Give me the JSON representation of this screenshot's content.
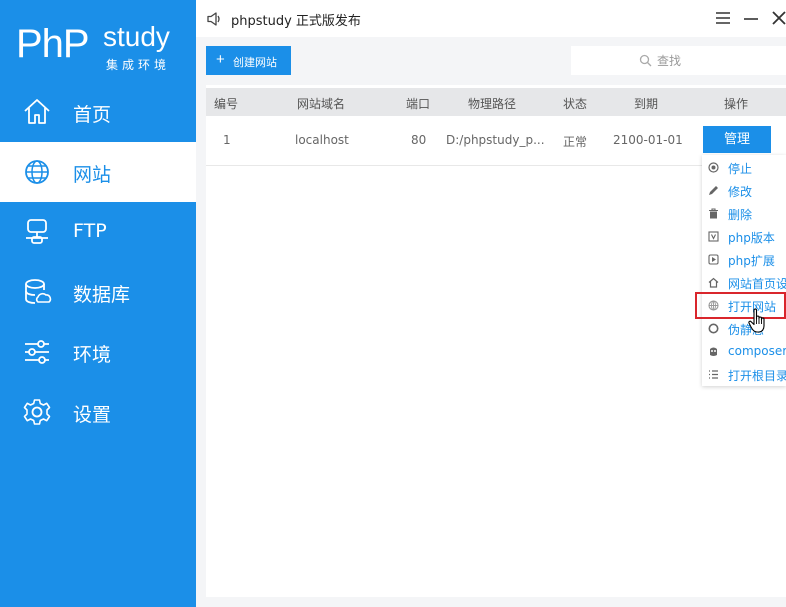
{
  "logo": {
    "php": "PhP",
    "study": "study",
    "subtitle": "集成环境"
  },
  "sidebar": {
    "items": [
      {
        "label": "首页",
        "icon": "home-icon"
      },
      {
        "label": "网站",
        "icon": "globe-icon",
        "active": true
      },
      {
        "label": "FTP",
        "icon": "ftp-server-icon"
      },
      {
        "label": "数据库",
        "icon": "database-icon"
      },
      {
        "label": "环境",
        "icon": "sliders-icon"
      },
      {
        "label": "设置",
        "icon": "gear-icon"
      }
    ]
  },
  "topbar": {
    "notice": "phpstudy 正式版发布"
  },
  "toolbar": {
    "create_label": "创建网站",
    "search_placeholder": "查找"
  },
  "table": {
    "headers": [
      "编号",
      "网站域名",
      "端口",
      "物理路径",
      "状态",
      "到期",
      "操作"
    ],
    "rows": [
      {
        "id": "1",
        "domain": "localhost",
        "port": "80",
        "path": "D:/phpstudy_p...",
        "status": "正常",
        "expire": "2100-01-01",
        "action": "管理"
      }
    ]
  },
  "menu": {
    "items": [
      {
        "label": "停止",
        "icon": "stop-icon"
      },
      {
        "label": "修改",
        "icon": "pencil-icon"
      },
      {
        "label": "删除",
        "icon": "trash-icon"
      },
      {
        "label": "php版本",
        "icon": "php-version-icon"
      },
      {
        "label": "php扩展",
        "icon": "php-extension-icon"
      },
      {
        "label": "网站首页设置",
        "icon": "home-icon"
      },
      {
        "label": "打开网站",
        "icon": "globe-icon",
        "highlighted": true
      },
      {
        "label": "伪静态",
        "icon": "rewrite-icon"
      },
      {
        "label": "composer",
        "icon": "composer-icon"
      },
      {
        "label": "打开根目录",
        "icon": "list-icon"
      }
    ]
  },
  "colors": {
    "accent": "#1b8fe8",
    "highlight": "#d9262c"
  }
}
